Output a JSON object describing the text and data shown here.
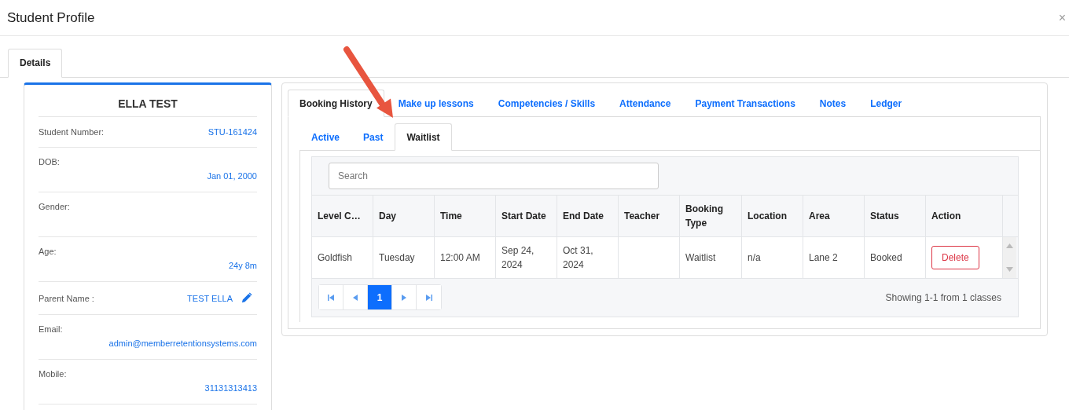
{
  "window": {
    "title": "Student Profile",
    "close": "×"
  },
  "tabs": [
    {
      "label": "Details",
      "selected": true
    }
  ],
  "profile": {
    "name": "ELLA TEST",
    "fields": [
      {
        "label": "Student Number:",
        "value": "STU-161424",
        "kind": "inline"
      },
      {
        "label": "DOB:",
        "value": "Jan 01, 2000",
        "kind": "stacked"
      },
      {
        "label": "Gender:",
        "kind": "stacked"
      },
      {
        "label": "Age:",
        "value": "24y 8m",
        "kind": "stacked"
      },
      {
        "label": "Parent Name :",
        "value": "TEST ELLA",
        "kind": "inline",
        "editable": true
      },
      {
        "label": "Email:",
        "value": "admin@memberretentionsystems.com",
        "kind": "stacked"
      },
      {
        "label": "Mobile:",
        "value": "31131313413",
        "kind": "stacked"
      }
    ]
  },
  "main_tabs": [
    {
      "label": "Booking History",
      "selected": true
    },
    {
      "label": "Make up lessons",
      "selected": false
    },
    {
      "label": "Competencies / Skills",
      "selected": false
    },
    {
      "label": "Attendance",
      "selected": false
    },
    {
      "label": "Payment Transactions",
      "selected": false
    },
    {
      "label": "Notes",
      "selected": false
    },
    {
      "label": "Ledger",
      "selected": false
    }
  ],
  "sub_tabs": [
    {
      "label": "Active",
      "selected": false
    },
    {
      "label": "Past",
      "selected": false
    },
    {
      "label": "Waitlist",
      "selected": true
    }
  ],
  "search": {
    "placeholder": "Search"
  },
  "table": {
    "columns": [
      "Level C…",
      "Day",
      "Time",
      "Start Date",
      "End Date",
      "Teacher",
      "Booking Type",
      "Location",
      "Area",
      "Status",
      "Action"
    ],
    "rows": [
      {
        "cells": [
          "Goldfish",
          "Tuesday",
          "12:00 AM",
          "Sep 24, 2024",
          "Oct 31, 2024",
          "",
          "Waitlist",
          "n/a",
          "Lane 2",
          "Booked"
        ],
        "action": "Delete"
      }
    ]
  },
  "pagination": {
    "pages": [
      {
        "label": "1",
        "selected": true
      }
    ],
    "summary": "Showing 1-1 from 1 classes"
  }
}
